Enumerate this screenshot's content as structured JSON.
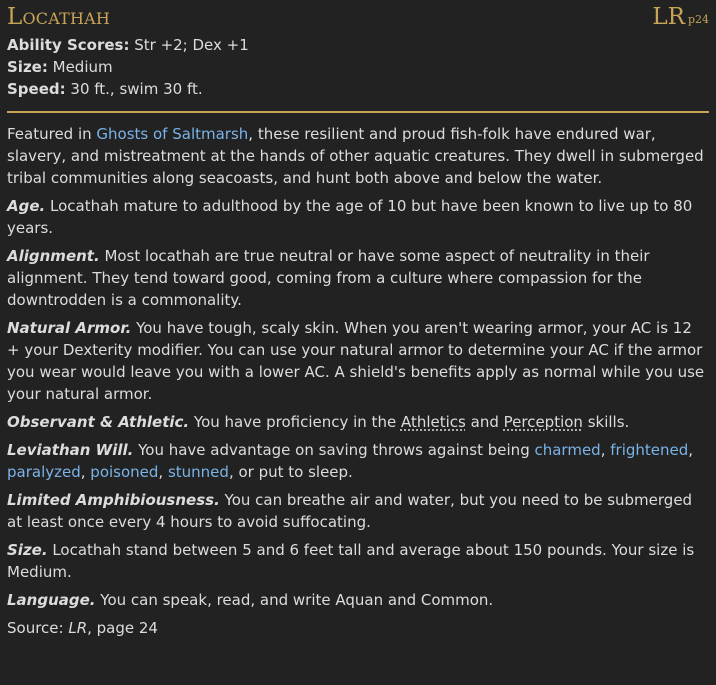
{
  "header": {
    "title": "Locathah",
    "source_abbr": "LR",
    "source_page": "p24"
  },
  "stats": [
    {
      "label": "Ability Scores:",
      "value": "Str +2; Dex +1"
    },
    {
      "label": "Size:",
      "value": "Medium"
    },
    {
      "label": "Speed:",
      "value": "30 ft., swim 30 ft."
    }
  ],
  "intro": {
    "pre": "Featured in ",
    "link": "Ghosts of Saltmarsh",
    "post": ", these resilient and proud fish-folk have endured war, slavery, and mistreatment at the hands of other aquatic creatures. They dwell in submerged tribal communities along seacoasts, and hunt both above and below the water."
  },
  "traits": {
    "age": {
      "name": "Age.",
      "text": " Locathah mature to adulthood by the age of 10 but have been known to live up to 80 years."
    },
    "alignment": {
      "name": "Alignment.",
      "text": " Most locathah are true neutral or have some aspect of neutrality in their alignment. They tend toward good, coming from a culture where compassion for the downtrodden is a commonality."
    },
    "natural_armor": {
      "name": "Natural Armor.",
      "text": " You have tough, scaly skin. When you aren't wearing armor, your AC is 12 + your Dexterity modifier. You can use your natural armor to determine your AC if the armor you wear would leave you with a lower AC. A shield's benefits apply as normal while you use your natural armor."
    },
    "observant": {
      "name": "Observant & Athletic.",
      "pre": " You have proficiency in the ",
      "skill1": "Athletics",
      "mid": " and ",
      "skill2": "Perception",
      "post": " skills."
    },
    "leviathan": {
      "name": "Leviathan Will.",
      "pre": " You have advantage on saving throws against being ",
      "c1": "charmed",
      "c2": "frightened",
      "c3": "paralyzed",
      "c4": "poisoned",
      "c5": "stunned",
      "sep": ", ",
      "post": ", or put to sleep."
    },
    "amphibious": {
      "name": "Limited Amphibiousness.",
      "text": " You can breathe air and water, but you need to be submerged at least once every 4 hours to avoid suffocating."
    },
    "size": {
      "name": "Size.",
      "text": " Locathah stand between 5 and 6 feet tall and average about 150 pounds. Your size is Medium."
    },
    "language": {
      "name": "Language.",
      "text": " You can speak, read, and write Aquan and Common."
    }
  },
  "source": {
    "label": "Source: ",
    "book": "LR",
    "page": ", page 24"
  }
}
